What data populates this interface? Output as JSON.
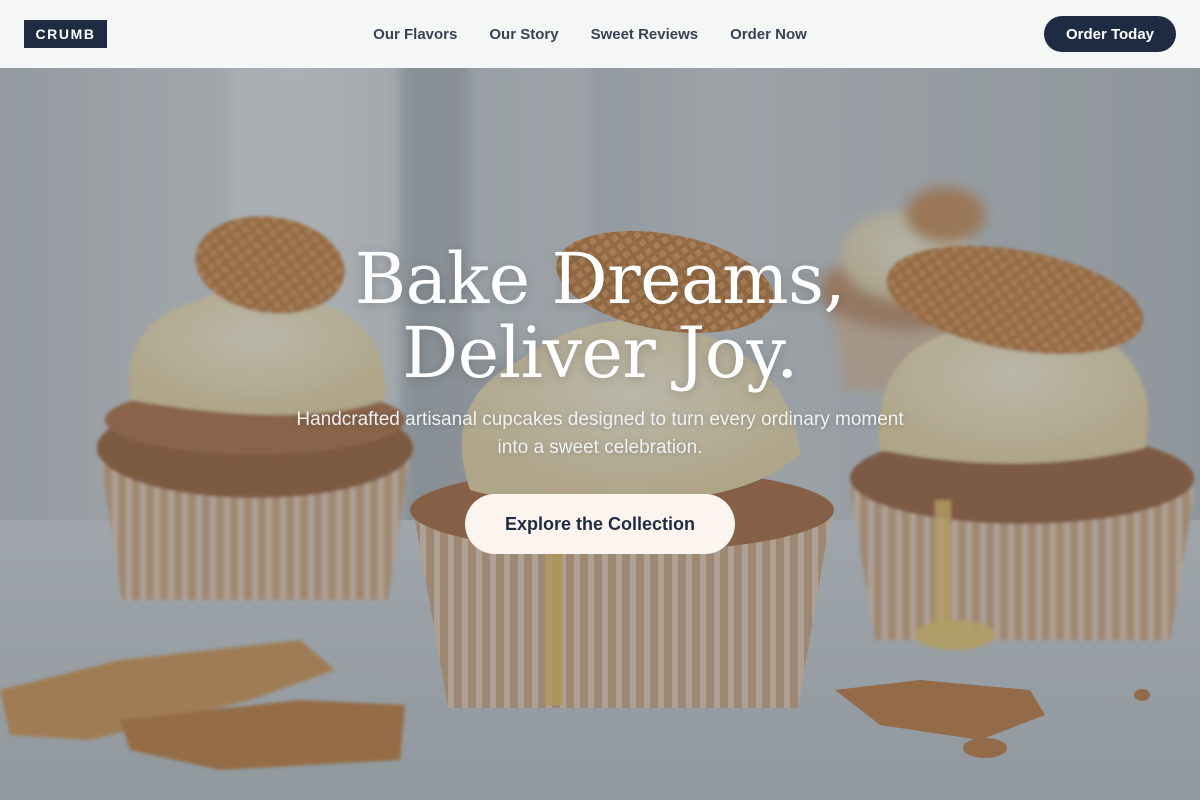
{
  "brand": {
    "logo_text": "CRUMB"
  },
  "nav": {
    "links": [
      "Our Flavors",
      "Our Story",
      "Sweet Reviews",
      "Order Now"
    ],
    "cta_label": "Order Today"
  },
  "hero": {
    "headline_line1": "Bake Dreams,",
    "headline_line2": "Deliver Joy.",
    "subheadline": "Handcrafted artisanal cupcakes designed to turn every ordinary moment into a sweet celebration.",
    "cta_label": "Explore the Collection",
    "background_image": "cupcakes-with-waffle-cookies-photo"
  },
  "colors": {
    "navy": "#1f2b42",
    "nav_background": "#f5f6f6",
    "cta_background": "#fcf5ef",
    "text_on_hero": "#ffffff"
  }
}
